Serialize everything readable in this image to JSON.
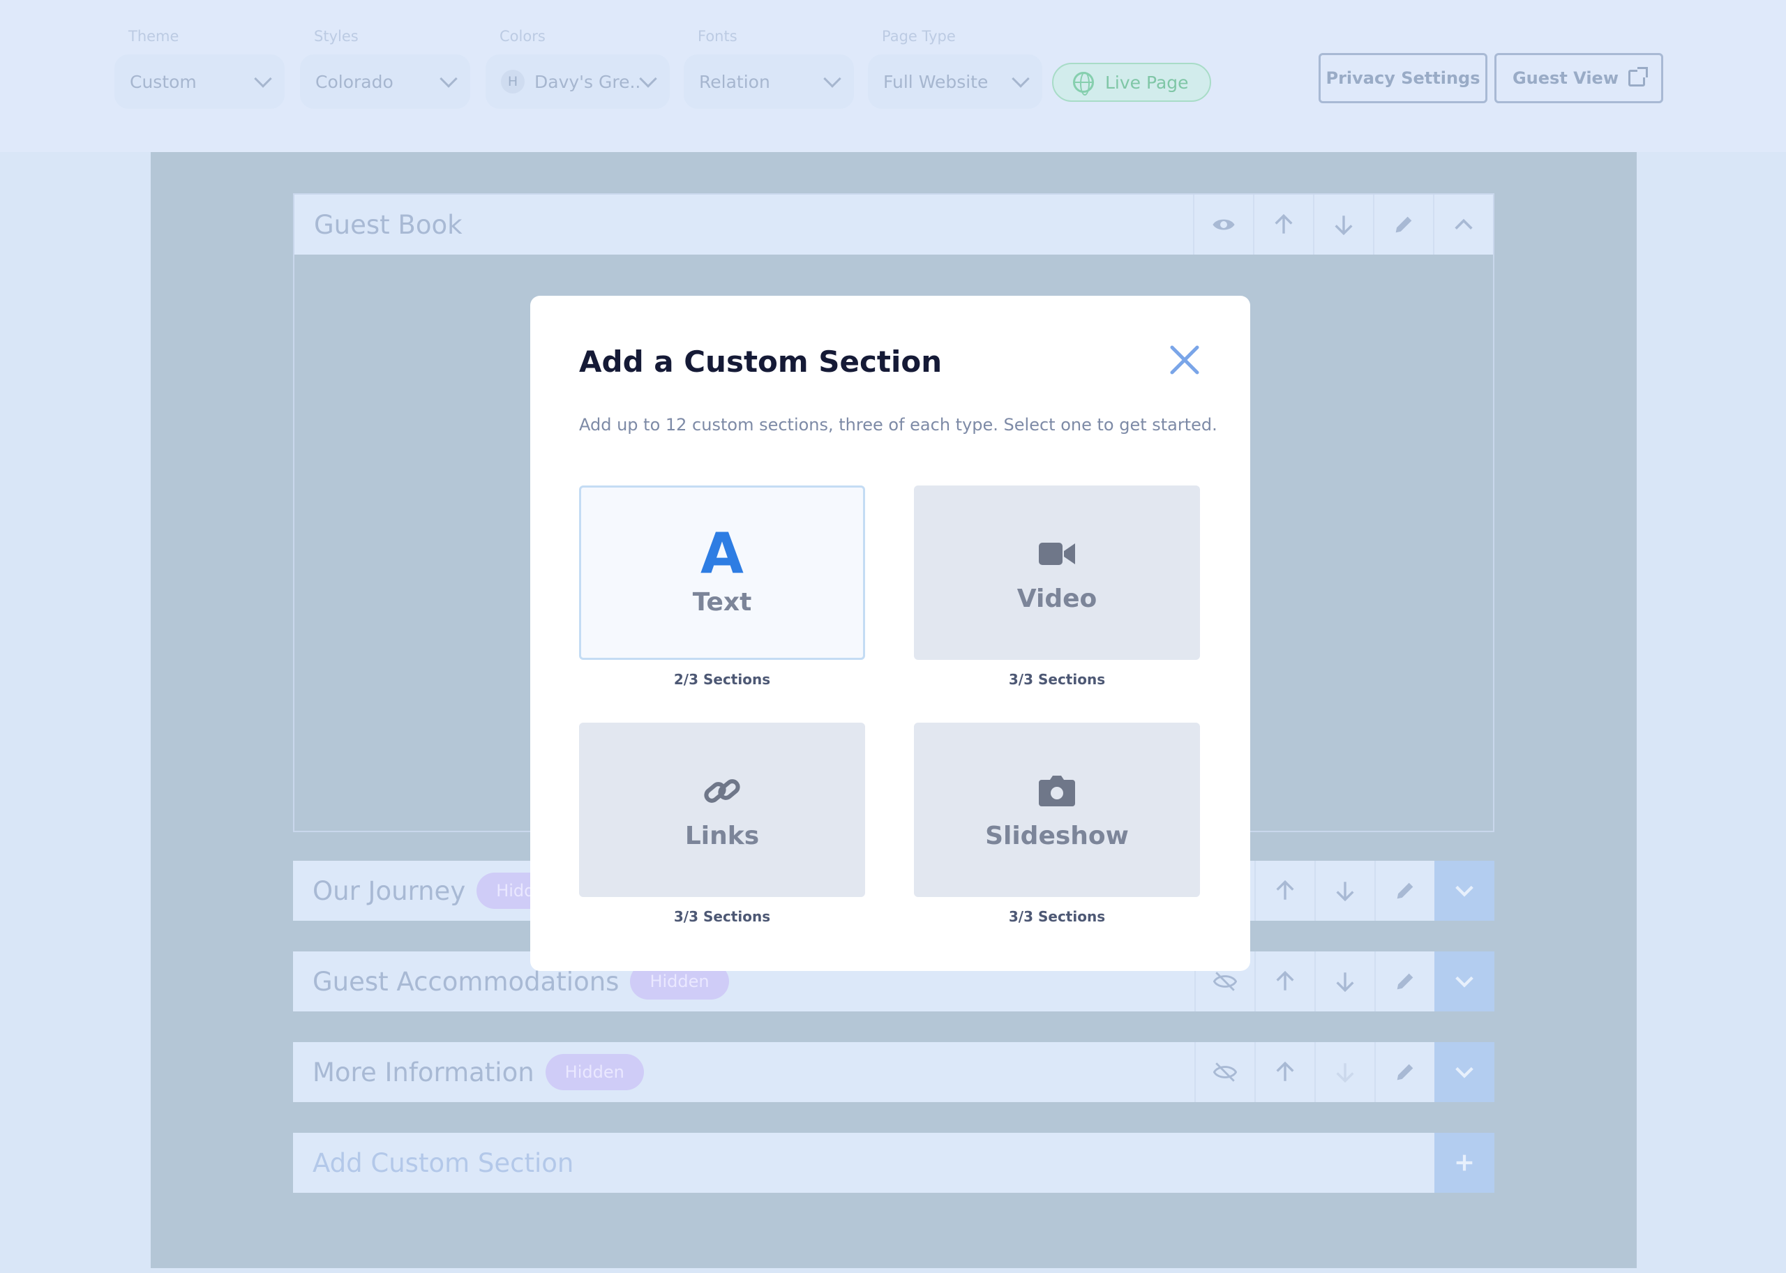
{
  "toolbar": {
    "theme": {
      "label": "Theme",
      "value": "Custom"
    },
    "styles": {
      "label": "Styles",
      "value": "Colorado"
    },
    "colors": {
      "label": "Colors",
      "avatar": "H",
      "value": "Davy's Gre..."
    },
    "fonts": {
      "label": "Fonts",
      "value": "Relation"
    },
    "page_type": {
      "label": "Page Type",
      "value": "Full Website"
    },
    "live_page": "Live Page",
    "privacy_settings": "Privacy Settings",
    "guest_view": "Guest View"
  },
  "sections": {
    "guest_book": {
      "title": "Guest Book"
    },
    "our_journey": {
      "title": "Our Journey",
      "badge": "Hidden"
    },
    "guest_accommodations": {
      "title": "Guest Accommodations",
      "badge": "Hidden"
    },
    "more_information": {
      "title": "More Information",
      "badge": "Hidden"
    },
    "add_custom": {
      "title": "Add Custom Section"
    }
  },
  "modal": {
    "title": "Add a Custom Section",
    "description": "Add up to 12 custom sections, three of each type. Select one to get started.",
    "options": [
      {
        "label": "Text",
        "glyph": "A",
        "count": "2/3 Sections",
        "icon": "text-icon"
      },
      {
        "label": "Video",
        "count": "3/3 Sections",
        "icon": "video-camera-icon"
      },
      {
        "label": "Links",
        "count": "3/3 Sections",
        "icon": "link-icon"
      },
      {
        "label": "Slideshow",
        "count": "3/3 Sections",
        "icon": "camera-icon"
      }
    ]
  },
  "colors": {
    "accent": "#2e7de3",
    "overlay": "#b4c6d6",
    "hidden_badge": "#cfccf7"
  }
}
